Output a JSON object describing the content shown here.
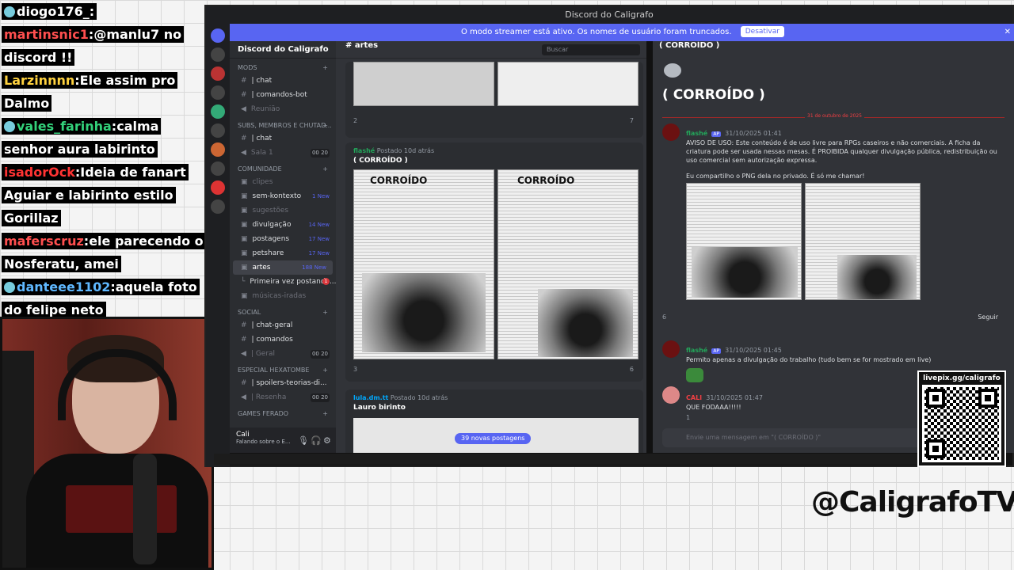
{
  "chat": [
    {
      "user": "diogo176_",
      "text": "",
      "color": "#ffffff",
      "badge": true
    },
    {
      "user": "martinsnic1",
      "text": "@manlu7 no discord !!",
      "color": "#ff4f4f"
    },
    {
      "user": "Larzinnnn",
      "text": "Ele assim pro Dalmo",
      "color": "#ffd23f"
    },
    {
      "user": "vales_farinha",
      "text": "calma senhor aura labirinto",
      "color": "#33d17a",
      "badge": true
    },
    {
      "user": "isadorOck",
      "text": "Ideia de fanart Aguiar e labirinto estilo Gorillaz",
      "color": "#ff3333"
    },
    {
      "user": "maferscruz",
      "text": "ele parecendo o Nosferatu, amei",
      "color": "#ff4f4f"
    },
    {
      "user": "danteee1102",
      "text": "aquela foto do felipe neto",
      "color": "#5fb8ff",
      "badge": true
    }
  ],
  "window": {
    "title": "Discord do Caligrafo"
  },
  "banner": {
    "text": "O modo streamer está ativo. Os nomes de usuário foram truncados.",
    "button": "Desativar"
  },
  "server": {
    "name": "Discord do Caligrafo"
  },
  "sidebar": {
    "sections": [
      {
        "name": "MODS",
        "channels": [
          {
            "label": "| chat",
            "kind": "text",
            "style": "white"
          },
          {
            "label": "| comandos-bot",
            "kind": "text",
            "style": "white"
          },
          {
            "label": "Reunião",
            "kind": "voice",
            "style": "muted"
          }
        ]
      },
      {
        "name": "SUBS, MEMBROS E CHUTAD...",
        "channels": [
          {
            "label": "| chat",
            "kind": "text",
            "style": "white"
          },
          {
            "label": "Sala 1",
            "kind": "voice",
            "style": "muted",
            "count": "00 20"
          }
        ]
      },
      {
        "name": "COMUNIDADE",
        "channels": [
          {
            "label": "clipes",
            "kind": "forum",
            "style": "muted"
          },
          {
            "label": "sem-kontexto",
            "kind": "forum",
            "style": "white",
            "new": "1 New"
          },
          {
            "label": "sugestões",
            "kind": "forum",
            "style": "muted"
          },
          {
            "label": "divulgação",
            "kind": "forum",
            "style": "white",
            "new": "14 New"
          },
          {
            "label": "postagens",
            "kind": "forum",
            "style": "white",
            "new": "17 New"
          },
          {
            "label": "petshare",
            "kind": "forum",
            "style": "white",
            "new": "17 New"
          },
          {
            "label": "artes",
            "kind": "forum",
            "style": "active",
            "new": "188 New"
          },
          {
            "label": "Primeira vez postando...",
            "kind": "thread",
            "style": "white",
            "red": "1"
          },
          {
            "label": "músicas-iradas",
            "kind": "forum",
            "style": "muted"
          }
        ]
      },
      {
        "name": "SOCIAL",
        "channels": [
          {
            "label": "| chat-geral",
            "kind": "text",
            "style": "white"
          },
          {
            "label": "| comandos",
            "kind": "text",
            "style": "white"
          },
          {
            "label": "| Geral",
            "kind": "voice",
            "style": "muted",
            "count": "00 20"
          }
        ]
      },
      {
        "name": "ESPECIAL HEXATOMBE",
        "channels": [
          {
            "label": "| spoilers-teorias-di...",
            "kind": "text",
            "style": "white"
          },
          {
            "label": "| Resenha",
            "kind": "voice",
            "style": "muted",
            "count": "00 20"
          }
        ]
      },
      {
        "name": "GAMES FERADO",
        "channels": []
      }
    ]
  },
  "user": {
    "name": "Cali",
    "status": "Falando sobre o E..."
  },
  "forum": {
    "channel": "artes",
    "search": "Buscar",
    "post1": {
      "count": "2",
      "reactions": "7"
    },
    "post2": {
      "author": "flashé",
      "time": "Postado 10d atrás",
      "title": "( CORROÍDO )",
      "count": "3",
      "reactions": "6",
      "sheet_title": "CORROÍDO"
    },
    "post3": {
      "author": "lula.dm.tt",
      "time": "Postado 10d atrás",
      "title": "Lauro birinto"
    },
    "new_posts": "39 novas postagens"
  },
  "thread": {
    "header": "( CORROÍDO )",
    "title": "( CORROÍDO )",
    "date": "31 de outubro de 2025",
    "msg1": {
      "author": "flashé",
      "tag": "AP",
      "time": "31/10/2025 01:41",
      "text": "AVISO DE USO: Este conteúdo é de uso livre para RPGs caseiros e não comerciais. A ficha da criatura pode ser usada nessas mesas. É PROIBIDA qualquer divulgação pública, redistribuição ou uso comercial sem autorização expressa.",
      "text2": "Eu compartilho o PNG dela no privado. É só me chamar!",
      "reactions": "6",
      "follow": "Seguir"
    },
    "msg2": {
      "author": "flashé",
      "tag": "AP",
      "time": "31/10/2025 01:45",
      "text": "Permito apenas a divulgação do trabalho (tudo bem se for mostrado em live)"
    },
    "msg3": {
      "author": "CALI",
      "time": "31/10/2025 01:47",
      "text": "QUE FODAAA!!!!!",
      "reactions": "1"
    },
    "composer": "Envie uma mensagem em \"( CORROÍDO )\""
  },
  "qr": {
    "label": "livepix.gg/caligrafo"
  },
  "handle": "@CaligrafoTV"
}
